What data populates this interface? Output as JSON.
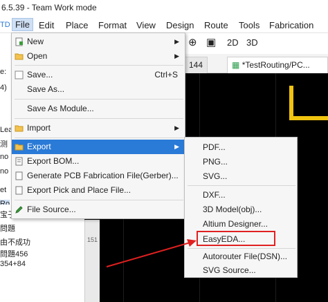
{
  "window": {
    "title": "6.5.39 - Team Work mode"
  },
  "menubar": {
    "partial_left": "TD",
    "items": [
      "File",
      "Edit",
      "Place",
      "Format",
      "View",
      "Design",
      "Route",
      "Tools",
      "Fabrication"
    ]
  },
  "toolbar": {
    "mode2d": "2D",
    "mode3d": "3D"
  },
  "tabs": [
    {
      "label": "144"
    },
    {
      "label": "*TestRouting/PC..."
    }
  ],
  "left_fragments": {
    "top": [
      "e:",
      "4)",
      "Lea",
      "测",
      "no",
      "no",
      "et",
      "Ro"
    ],
    "bottom": [
      "宝子",
      "問題",
      "由不成功",
      "問題456",
      "354+84"
    ]
  },
  "ruler": {
    "label": "151"
  },
  "file_menu": {
    "items": [
      {
        "label": "New",
        "shortcut": "",
        "submenu": true,
        "icon": "new-file-icon"
      },
      {
        "label": "Open",
        "shortcut": "",
        "submenu": true,
        "icon": "folder-icon"
      },
      {
        "label": "Save...",
        "shortcut": "Ctrl+S",
        "submenu": false,
        "icon": "save-icon"
      },
      {
        "label": "Save As...",
        "shortcut": "",
        "submenu": false,
        "icon": ""
      },
      {
        "label": "Save As Module...",
        "shortcut": "",
        "submenu": false,
        "icon": ""
      },
      {
        "label": "Import",
        "shortcut": "",
        "submenu": true,
        "icon": "import-icon"
      },
      {
        "label": "Export",
        "shortcut": "",
        "submenu": true,
        "icon": "export-icon"
      },
      {
        "label": "Export BOM...",
        "shortcut": "",
        "submenu": false,
        "icon": "bom-icon"
      },
      {
        "label": "Generate PCB Fabrication File(Gerber)...",
        "shortcut": "",
        "submenu": false,
        "icon": "gerber-icon"
      },
      {
        "label": "Export Pick and Place File...",
        "shortcut": "",
        "submenu": false,
        "icon": "pick-place-icon"
      },
      {
        "label": "File Source...",
        "shortcut": "",
        "submenu": false,
        "icon": "pencil-icon"
      }
    ]
  },
  "export_menu": {
    "items": [
      "PDF...",
      "PNG...",
      "SVG...",
      "DXF...",
      "3D Model(obj)...",
      "Altium Designer...",
      "EasyEDA...",
      "Autorouter File(DSN)...",
      "SVG Source..."
    ],
    "highlighted": "EasyEDA..."
  },
  "colors": {
    "highlight": "#2a7ad7",
    "annotation": "#e02020",
    "board_outline": "#f1c40f"
  }
}
